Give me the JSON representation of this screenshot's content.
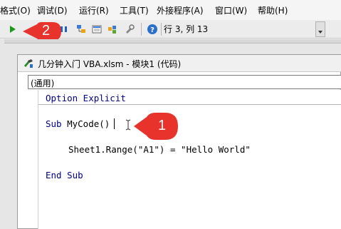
{
  "menu": {
    "items": [
      {
        "label": "格式(O)"
      },
      {
        "label": "调试(D)"
      },
      {
        "label": "运行(R)"
      },
      {
        "label": "工具(T)"
      },
      {
        "label": "外接程序(A)"
      },
      {
        "label": "窗口(W)"
      },
      {
        "label": "帮助(H)"
      }
    ]
  },
  "toolbar": {
    "position_text": "行 3, 列 13",
    "icons": [
      "run-icon",
      "break-icon",
      "reset-icon",
      "design-mode-icon",
      "project-explorer-icon",
      "properties-icon",
      "object-browser-icon",
      "toolbox-icon",
      "help-icon"
    ]
  },
  "code_window": {
    "title": "几分钟入门 VBA.xlsm - 模块1 (代码)",
    "object_combo": "(通用)"
  },
  "code": {
    "line1_kw": "Option Explicit",
    "line2_kw": "Sub",
    "line2_txt": " MyCode()",
    "line3_txt": "Sheet1.Range(\"A1\") = \"Hello World\"",
    "line4_kw": "End Sub"
  },
  "callouts": {
    "one": "1",
    "two": "2"
  },
  "colors": {
    "callout_red": "#e8322c",
    "keyword_blue": "#00008b"
  }
}
